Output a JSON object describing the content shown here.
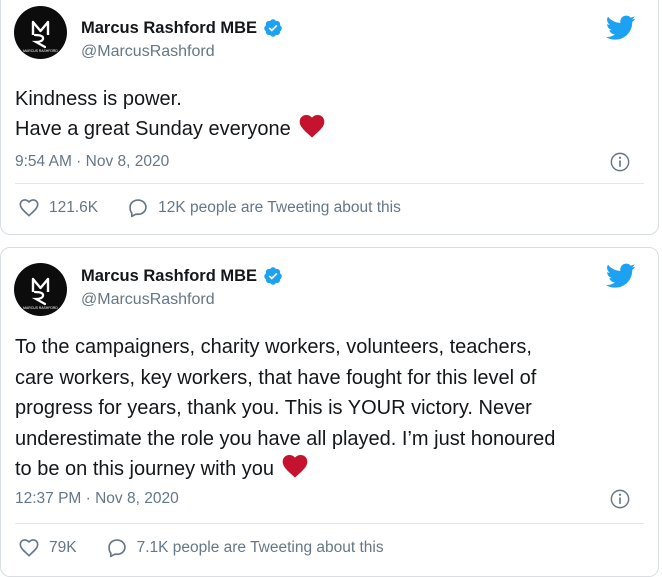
{
  "colors": {
    "accent": "#1da1f2",
    "heart": "#e0245e",
    "secondary_text": "#657786"
  },
  "tweets": [
    {
      "author": {
        "name": "Marcus Rashford MBE",
        "handle": "@MarcusRashford",
        "avatar_text": "MARCUS RASHFORD",
        "verified": true
      },
      "text": "Kindness is power.\nHave a great Sunday everyone",
      "emoji": "red-heart",
      "timestamp": "9:54 AM · Nov 8, 2020",
      "likes": "121.6K",
      "conversation": "12K people are Tweeting about this"
    },
    {
      "author": {
        "name": "Marcus Rashford MBE",
        "handle": "@MarcusRashford",
        "avatar_text": "MARCUS RASHFORD",
        "verified": true
      },
      "text": "To the campaigners, charity workers, volunteers, teachers,\ncare workers, key workers, that have fought for this level of\nprogress for years, thank you. This is YOUR victory. Never\nunderestimate the role you have all played. I’m just honoured\nto be on this journey with you",
      "emoji": "red-heart",
      "timestamp": "12:37 PM · Nov 8, 2020",
      "likes": "79K",
      "conversation": "7.1K people are Tweeting about this"
    }
  ]
}
